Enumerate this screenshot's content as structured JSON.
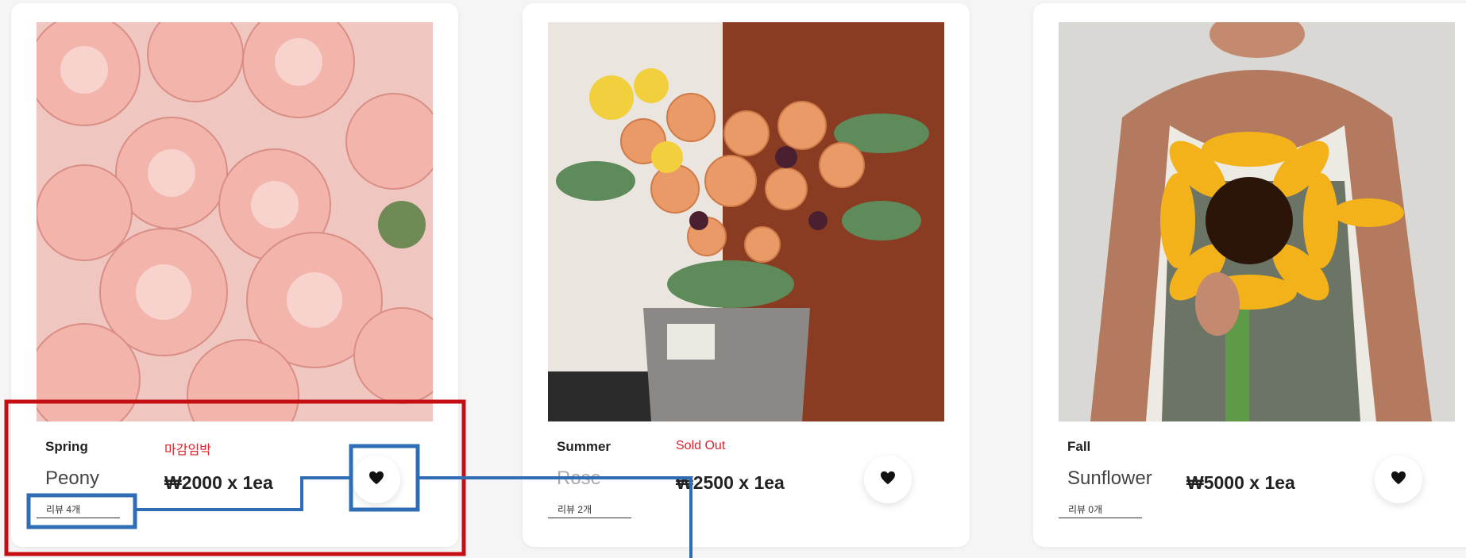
{
  "products": [
    {
      "season": "Spring",
      "badge": "마감임박",
      "name": "Peony",
      "price": "₩2000 x 1ea",
      "review": "리뷰 4개"
    },
    {
      "season": "Summer",
      "badge": "Sold Out",
      "name": "Rose",
      "price": "₩2500 x 1ea",
      "review": "리뷰 2개"
    },
    {
      "season": "Fall",
      "badge": "",
      "name": "Sunflower",
      "price": "₩5000 x 1ea",
      "review": "리뷰 0개"
    }
  ],
  "icons": {
    "like": "heart-icon"
  },
  "colors": {
    "badge": "#e0202a",
    "annotation_red": "#c40f14",
    "annotation_blue": "#2f6db5"
  }
}
